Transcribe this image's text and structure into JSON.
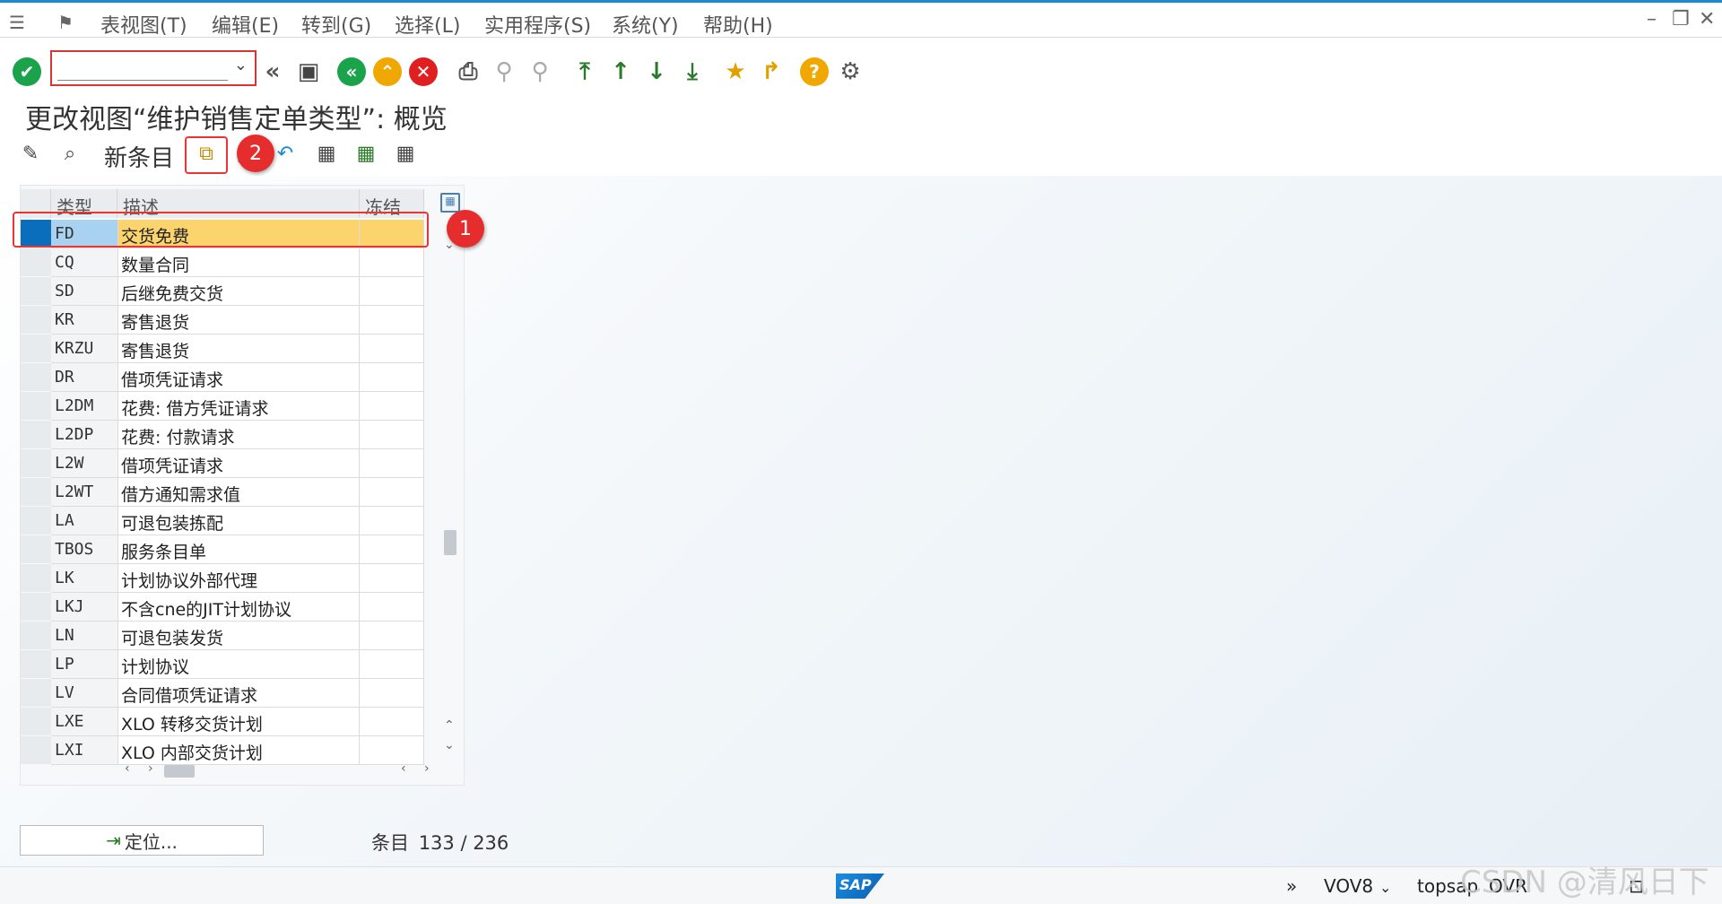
{
  "menubar": {
    "items": [
      "表视图(T)",
      "编辑(E)",
      "转到(G)",
      "选择(L)",
      "实用程序(S)",
      "系统(Y)",
      "帮助(H)"
    ]
  },
  "command_field": {
    "value": ""
  },
  "page_title": "更改视图“维护销售定单类型”: 概览",
  "app_toolbar": {
    "new_entries_label": "新条目"
  },
  "table": {
    "columns": [
      "类型",
      "描述",
      "冻结"
    ],
    "rows": [
      {
        "type": "FD",
        "desc": "交货免费",
        "frozen": ""
      },
      {
        "type": "CQ",
        "desc": "数量合同",
        "frozen": ""
      },
      {
        "type": "SD",
        "desc": "后继免费交货",
        "frozen": ""
      },
      {
        "type": "KR",
        "desc": "寄售退货",
        "frozen": ""
      },
      {
        "type": "KRZU",
        "desc": "寄售退货",
        "frozen": ""
      },
      {
        "type": "DR",
        "desc": "借项凭证请求",
        "frozen": ""
      },
      {
        "type": "L2DM",
        "desc": "花费: 借方凭证请求",
        "frozen": ""
      },
      {
        "type": "L2DP",
        "desc": "花费: 付款请求",
        "frozen": ""
      },
      {
        "type": "L2W",
        "desc": "借项凭证请求",
        "frozen": ""
      },
      {
        "type": "L2WT",
        "desc": "借方通知需求值",
        "frozen": ""
      },
      {
        "type": "LA",
        "desc": "可退包装拣配",
        "frozen": ""
      },
      {
        "type": "TBOS",
        "desc": "服务条目单",
        "frozen": ""
      },
      {
        "type": "LK",
        "desc": "计划协议外部代理",
        "frozen": ""
      },
      {
        "type": "LKJ",
        "desc": "不含cne的JIT计划协议",
        "frozen": ""
      },
      {
        "type": "LN",
        "desc": "可退包装发货",
        "frozen": ""
      },
      {
        "type": "LP",
        "desc": "计划协议",
        "frozen": ""
      },
      {
        "type": "LV",
        "desc": "合同借项凭证请求",
        "frozen": ""
      },
      {
        "type": "LXE",
        "desc": "XLO 转移交货计划",
        "frozen": ""
      },
      {
        "type": "LXI",
        "desc": "XLO 内部交货计划",
        "frozen": ""
      }
    ],
    "selected_row": 0
  },
  "footer": {
    "locate_label": "定位...",
    "entries_label": "条目",
    "entries_value": "133 / 236"
  },
  "annotations": {
    "badge1": "1",
    "badge2": "2"
  },
  "statusbar": {
    "sap_logo": "SAP",
    "transaction": "VOV8",
    "system": "topsap",
    "mode": "OVR"
  },
  "watermark": "CSDN @清风日下",
  "colors": {
    "accent": "#1a8ad4",
    "selected_row": "#fbd46e",
    "highlight": "#e33333",
    "ok": "#1aa34a",
    "cancel": "#e02020"
  }
}
